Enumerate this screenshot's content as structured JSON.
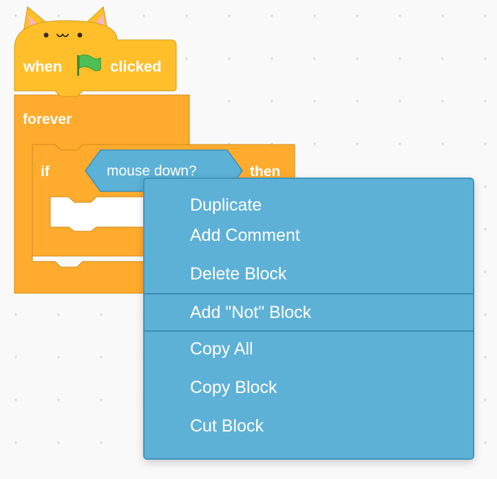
{
  "canvas": {
    "background": "#f9f9f9"
  },
  "colors": {
    "events_block": "#ffbf2a",
    "control_block": "#ffab2d",
    "sensing_reporter": "#5cb1d6",
    "menu_background": "#5eb1d6",
    "flag_green": "#4cbf56"
  },
  "hat_block": {
    "cat_face": "• ω •",
    "label_when": "when",
    "flag_icon": "green-flag",
    "label_clicked": "clicked"
  },
  "forever_block": {
    "label": "forever"
  },
  "if_block": {
    "label_if": "if",
    "condition": "mouse down?",
    "label_then": "then"
  },
  "context_menu": {
    "items": [
      {
        "label": "Duplicate"
      },
      {
        "label": "Add Comment"
      },
      {
        "label": "Delete Block"
      },
      {
        "label": "Add \"Not\" Block"
      },
      {
        "label": "Copy All"
      },
      {
        "label": "Copy Block"
      },
      {
        "label": "Cut Block"
      }
    ]
  }
}
